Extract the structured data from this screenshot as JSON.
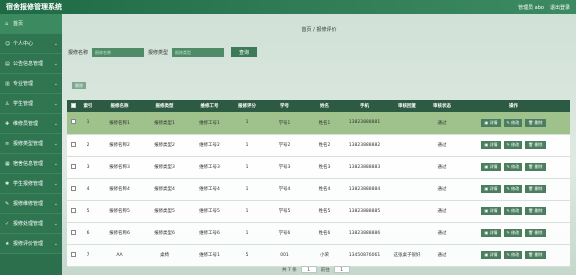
{
  "app": {
    "title": "宿舍报修管理系统",
    "user": "管理员 abo",
    "logout": "退出登录"
  },
  "sidebar": {
    "items": [
      {
        "label": "首页",
        "icon": "home-icon"
      },
      {
        "label": "个人中心",
        "icon": "person-icon"
      },
      {
        "label": "公告信息管理",
        "icon": "notice-icon"
      },
      {
        "label": "专业管理",
        "icon": "book-icon"
      },
      {
        "label": "学生管理",
        "icon": "user-icon"
      },
      {
        "label": "维修员管理",
        "icon": "tool-icon"
      },
      {
        "label": "报修类型管理",
        "icon": "list-icon"
      },
      {
        "label": "宿舍信息管理",
        "icon": "building-icon"
      },
      {
        "label": "学生报修管理",
        "icon": "wrench-icon"
      },
      {
        "label": "报修维修管理",
        "icon": "repair-icon"
      },
      {
        "label": "报修处理管理",
        "icon": "check-icon"
      },
      {
        "label": "报修评价管理",
        "icon": "star-icon"
      }
    ]
  },
  "breadcrumb": {
    "home": "首页",
    "sep": "/",
    "current": "报修评价"
  },
  "search": {
    "name_label": "报修名称",
    "name_placeholder": "报修名称",
    "type_label": "报修类型",
    "type_placeholder": "报修类型",
    "button": "查询"
  },
  "delete_batch": "删除",
  "table": {
    "headers": [
      "索引",
      "报修名称",
      "报修类型",
      "维修工号",
      "报修评分",
      "学号",
      "姓名",
      "手机",
      "审核回复",
      "审核状态",
      "操作"
    ],
    "rows": [
      [
        "1",
        "报修名称1",
        "报修类型1",
        "维修工号1",
        "1",
        "学号1",
        "姓名1",
        "13823888881",
        "",
        "通过"
      ],
      [
        "2",
        "报修名称2",
        "报修类型2",
        "维修工号2",
        "1",
        "学号2",
        "姓名2",
        "13823888882",
        "",
        "通过"
      ],
      [
        "3",
        "报修名称3",
        "报修类型3",
        "维修工号3",
        "1",
        "学号3",
        "姓名3",
        "13823888883",
        "",
        "通过"
      ],
      [
        "4",
        "报修名称4",
        "报修类型4",
        "维修工号4",
        "1",
        "学号4",
        "姓名4",
        "13823888884",
        "",
        "通过"
      ],
      [
        "5",
        "报修名称5",
        "报修类型5",
        "维修工号5",
        "1",
        "学号5",
        "姓名5",
        "13823888885",
        "",
        "通过"
      ],
      [
        "6",
        "报修名称6",
        "报修类型6",
        "维修工号6",
        "1",
        "学号6",
        "姓名6",
        "13823888886",
        "",
        "通过"
      ],
      [
        "7",
        "AA",
        "桌椅",
        "维修工号1",
        "5",
        "001",
        "小荣",
        "13450876061",
        "这张桌子很好",
        "通过"
      ]
    ],
    "ops": [
      "详情",
      "修改",
      "删除"
    ]
  },
  "pagination": {
    "total": "共 7 条",
    "page": "1",
    "goto": "前往",
    "goto_page": "1"
  }
}
